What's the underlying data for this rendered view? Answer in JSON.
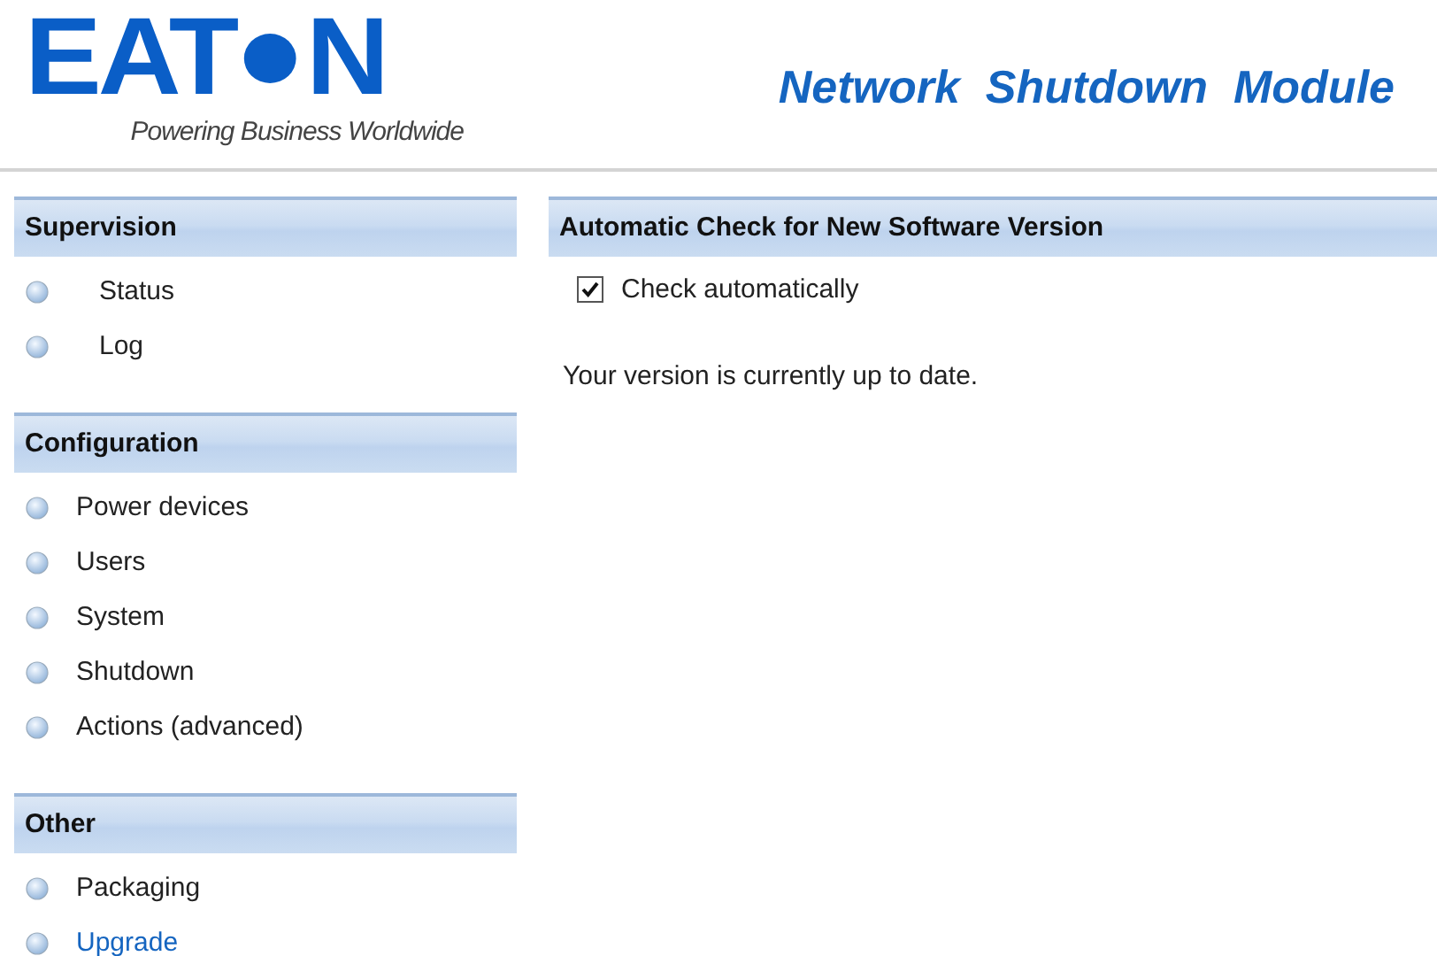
{
  "logo": {
    "letters_left": "EAT",
    "letters_right": "N",
    "tagline": "Powering Business Worldwide"
  },
  "product_title": "Network  Shutdown  Module",
  "sidebar": {
    "sections": [
      {
        "title": "Supervision",
        "indented": true,
        "items": [
          {
            "label": "Status",
            "selected": false
          },
          {
            "label": "Log",
            "selected": false
          }
        ]
      },
      {
        "title": "Configuration",
        "indented": false,
        "items": [
          {
            "label": "Power devices",
            "selected": false
          },
          {
            "label": "Users",
            "selected": false
          },
          {
            "label": "System",
            "selected": false
          },
          {
            "label": "Shutdown",
            "selected": false
          },
          {
            "label": "Actions (advanced)",
            "selected": false
          }
        ]
      },
      {
        "title": "Other",
        "indented": false,
        "items": [
          {
            "label": "Packaging",
            "selected": false
          },
          {
            "label": "Upgrade",
            "selected": true
          }
        ]
      }
    ]
  },
  "panel": {
    "title": "Automatic Check for New Software Version",
    "checkbox": {
      "label": "Check automatically",
      "checked": true
    },
    "message": "Your version is currently up to date."
  }
}
